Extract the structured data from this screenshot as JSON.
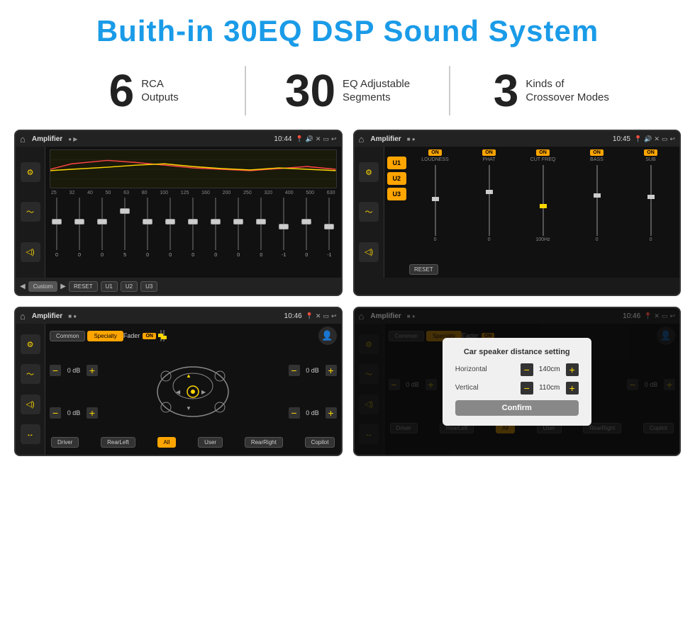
{
  "header": {
    "title": "Buith-in 30EQ DSP Sound System"
  },
  "stats": [
    {
      "number": "6",
      "label_line1": "RCA",
      "label_line2": "Outputs"
    },
    {
      "number": "30",
      "label_line1": "EQ Adjustable",
      "label_line2": "Segments"
    },
    {
      "number": "3",
      "label_line1": "Kinds of",
      "label_line2": "Crossover Modes"
    }
  ],
  "screen1": {
    "app": "Amplifier",
    "time": "10:44",
    "freq_labels": [
      "25",
      "32",
      "40",
      "50",
      "63",
      "80",
      "100",
      "125",
      "160",
      "200",
      "250",
      "320",
      "400",
      "500",
      "630"
    ],
    "slider_values": [
      "0",
      "0",
      "0",
      "5",
      "0",
      "0",
      "0",
      "0",
      "0",
      "0",
      "-1",
      "0",
      "-1"
    ],
    "bottom_btns": [
      "Custom",
      "RESET",
      "U1",
      "U2",
      "U3"
    ]
  },
  "screen2": {
    "app": "Amplifier",
    "time": "10:45",
    "u_buttons": [
      "U1",
      "U2",
      "U3"
    ],
    "controls": [
      "LOUDNESS",
      "PHAT",
      "CUT FREQ",
      "BASS",
      "SUB"
    ],
    "reset_btn": "RESET"
  },
  "screen3": {
    "app": "Amplifier",
    "time": "10:46",
    "tabs": [
      "Common",
      "Specialty"
    ],
    "fader_label": "Fader",
    "on": "ON",
    "vol_rows": [
      {
        "value": "0 dB"
      },
      {
        "value": "0 dB"
      },
      {
        "value": "0 dB"
      },
      {
        "value": "0 dB"
      }
    ],
    "btns": [
      "Driver",
      "Copilot",
      "RearLeft",
      "All",
      "User",
      "RearRight"
    ]
  },
  "screen4": {
    "app": "Amplifier",
    "time": "10:46",
    "tabs": [
      "Common",
      "Specialty"
    ],
    "dialog": {
      "title": "Car speaker distance setting",
      "rows": [
        {
          "label": "Horizontal",
          "value": "140cm"
        },
        {
          "label": "Vertical",
          "value": "110cm"
        }
      ],
      "confirm_btn": "Confirm"
    },
    "vol_rows": [
      {
        "value": "0 dB"
      },
      {
        "value": "0 dB"
      }
    ],
    "btns": [
      "Driver",
      "Copilot",
      "RearLeft",
      "All",
      "User",
      "RearRight"
    ]
  }
}
